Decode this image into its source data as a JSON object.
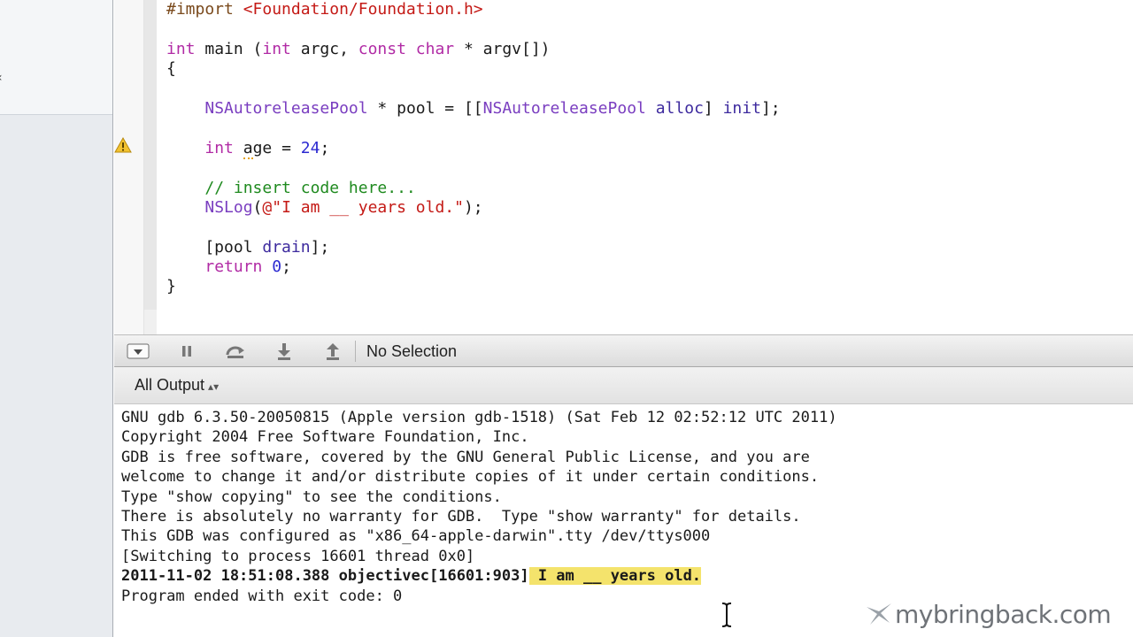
{
  "editor": {
    "code_lines": [
      [
        {
          "t": "#import ",
          "c": "pre"
        },
        {
          "t": "<Foundation/Foundation.h>",
          "c": "str"
        }
      ],
      [],
      [
        {
          "t": "int",
          "c": "kw"
        },
        {
          "t": " main ("
        },
        {
          "t": "int",
          "c": "kw"
        },
        {
          "t": " argc, "
        },
        {
          "t": "const",
          "c": "kw"
        },
        {
          "t": " "
        },
        {
          "t": "char",
          "c": "kw"
        },
        {
          "t": " * argv[])"
        }
      ],
      [
        {
          "t": "{"
        }
      ],
      [],
      [
        {
          "t": "    "
        },
        {
          "t": "NSAutoreleasePool",
          "c": "cls"
        },
        {
          "t": " * pool = [["
        },
        {
          "t": "NSAutoreleasePool",
          "c": "cls"
        },
        {
          "t": " "
        },
        {
          "t": "alloc",
          "c": "meth"
        },
        {
          "t": "] "
        },
        {
          "t": "init",
          "c": "meth"
        },
        {
          "t": "];"
        }
      ],
      [],
      [
        {
          "t": "    "
        },
        {
          "t": "int",
          "c": "kw"
        },
        {
          "t": " "
        },
        {
          "t": "a",
          "c": "warn"
        },
        {
          "t": "ge = "
        },
        {
          "t": "24",
          "c": "num"
        },
        {
          "t": ";"
        }
      ],
      [],
      [
        {
          "t": "    "
        },
        {
          "t": "// insert code here...",
          "c": "cmt"
        }
      ],
      [
        {
          "t": "    "
        },
        {
          "t": "NSLog",
          "c": "cls"
        },
        {
          "t": "("
        },
        {
          "t": "@\"I am __ years old.\"",
          "c": "str"
        },
        {
          "t": ");"
        }
      ],
      [],
      [
        {
          "t": "    [pool "
        },
        {
          "t": "drain",
          "c": "meth"
        },
        {
          "t": "];"
        }
      ],
      [
        {
          "t": "    "
        },
        {
          "t": "return",
          "c": "kw"
        },
        {
          "t": " "
        },
        {
          "t": "0",
          "c": "num"
        },
        {
          "t": ";"
        }
      ],
      [
        {
          "t": "}"
        }
      ]
    ],
    "warning_line": 8
  },
  "debug_bar": {
    "buttons": [
      {
        "name": "toggle-console-button",
        "icon": "panel-toggle-icon"
      },
      {
        "name": "pause-button",
        "icon": "pause-icon"
      },
      {
        "name": "step-over-button",
        "icon": "step-over-icon"
      },
      {
        "name": "step-into-button",
        "icon": "step-into-icon"
      },
      {
        "name": "step-out-button",
        "icon": "step-out-icon"
      }
    ],
    "selection_label": "No Selection"
  },
  "output": {
    "filter_label": "All Output",
    "lines": [
      {
        "text": "GNU gdb 6.3.50-20050815 (Apple version gdb-1518) (Sat Feb 12 02:52:12 UTC 2011)"
      },
      {
        "text": "Copyright 2004 Free Software Foundation, Inc."
      },
      {
        "text": "GDB is free software, covered by the GNU General Public License, and you are"
      },
      {
        "text": "welcome to change it and/or distribute copies of it under certain conditions."
      },
      {
        "text": "Type \"show copying\" to see the conditions."
      },
      {
        "text": "There is absolutely no warranty for GDB.  Type \"show warranty\" for details."
      },
      {
        "text": "This GDB was configured as \"x86_64-apple-darwin\".tty /dev/ttys000"
      },
      {
        "text": "[Switching to process 16601 thread 0x0]"
      },
      {
        "text": "2011-11-02 18:51:08.388 objectivec[16601:903]",
        "bold": true,
        "highlight_text": " I am __ years old."
      },
      {
        "text": "Program ended with exit code: 0"
      }
    ]
  },
  "watermark": {
    "text": "mybringback.com"
  },
  "colors": {
    "keyword": "#b12ba5",
    "string": "#c41a16",
    "class": "#7a3ec0",
    "comment": "#1f8a1f",
    "number": "#2c2ad1",
    "highlight": "#f4e36c"
  }
}
